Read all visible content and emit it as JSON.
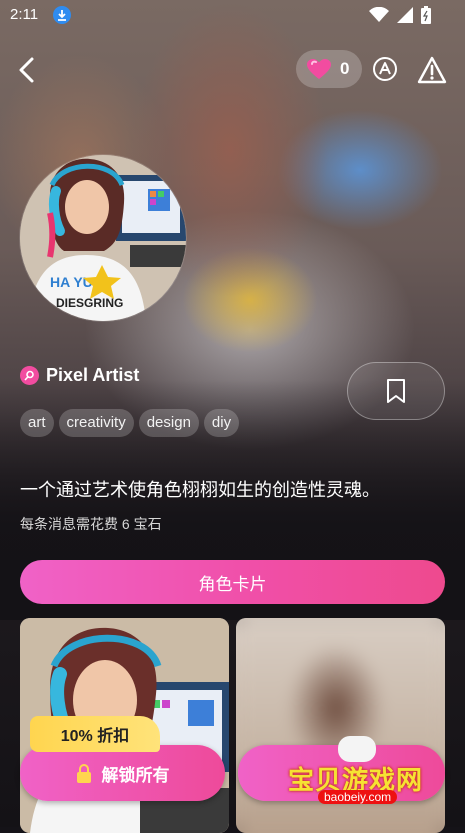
{
  "status_bar": {
    "time": "2:11"
  },
  "header": {
    "gem_count": "0"
  },
  "character": {
    "name": "Pixel Artist",
    "tags": [
      "art",
      "creativity",
      "design",
      "diy"
    ],
    "description": "一个通过艺术使角色栩栩如生的创造性灵魂。",
    "cost_text": "每条消息需花费 6 宝石",
    "shirt_text": [
      "HA YU U",
      "DIESGRING"
    ]
  },
  "actions": {
    "character_card": "角色卡片",
    "discount": "10% 折扣",
    "unlock_all": "解锁所有"
  },
  "watermark": {
    "text": "宝贝游戏网",
    "url": "baobeiy.com"
  },
  "colors": {
    "accent_pink": "#f04fa8",
    "discount_yellow": "#ffd54f"
  }
}
